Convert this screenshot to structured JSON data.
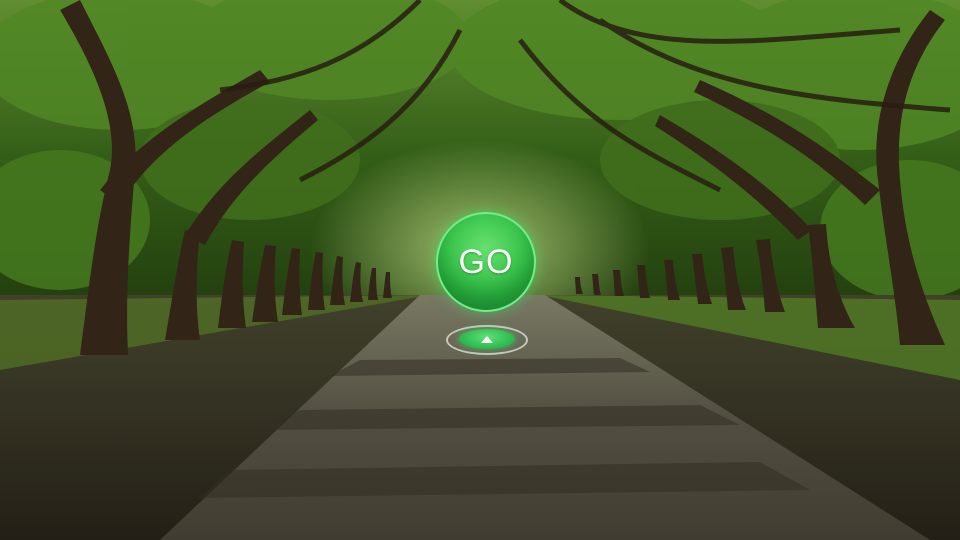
{
  "scene": {
    "description_icon": "forest-road-background"
  },
  "go_button": {
    "label": "GO",
    "color": "#2cc24d"
  },
  "move_forward": {
    "icon": "up-arrow-icon",
    "color": "#29b84a"
  }
}
